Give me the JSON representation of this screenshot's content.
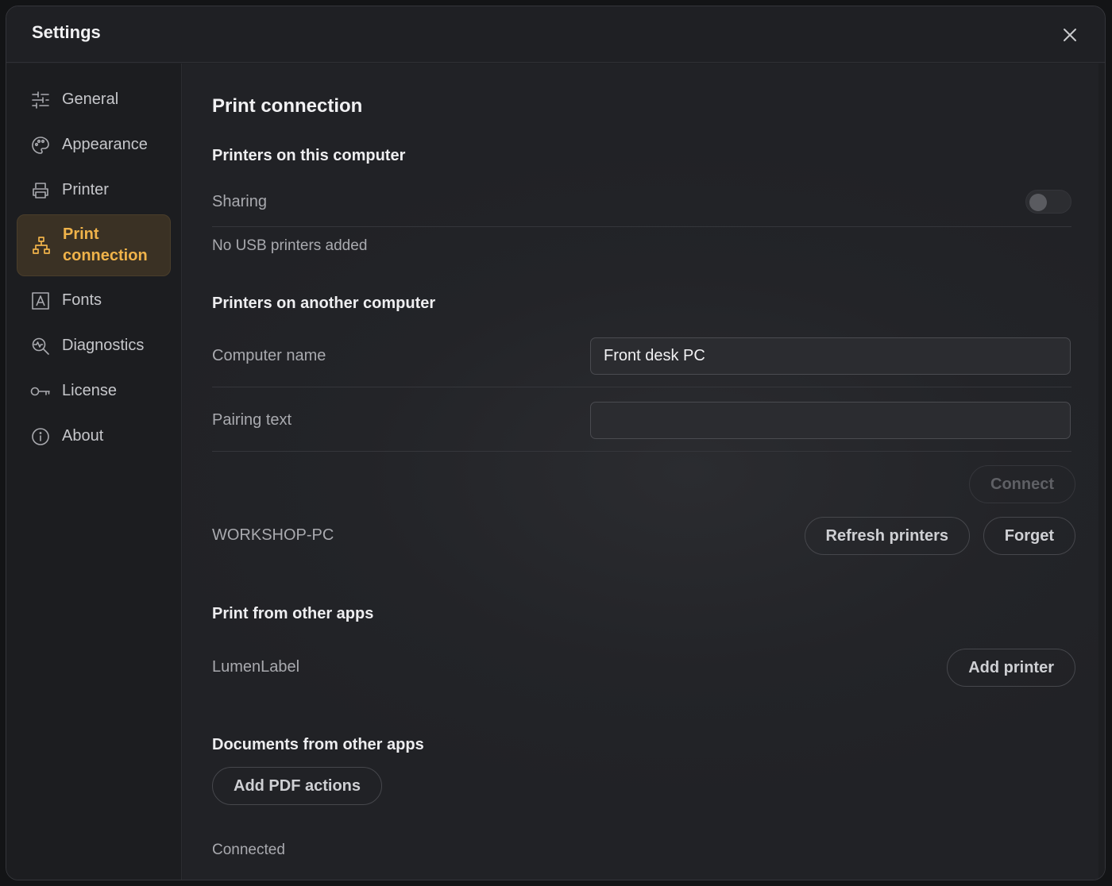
{
  "window": {
    "title": "Settings"
  },
  "sidebar": {
    "items": [
      {
        "label": "General",
        "icon": "sliders-icon"
      },
      {
        "label": "Appearance",
        "icon": "palette-icon"
      },
      {
        "label": "Printer",
        "icon": "printer-icon"
      },
      {
        "label": "Print\nconnection",
        "icon": "network-icon",
        "active": true
      },
      {
        "label": "Fonts",
        "icon": "font-icon"
      },
      {
        "label": "Diagnostics",
        "icon": "diagnostics-icon"
      },
      {
        "label": "License",
        "icon": "key-icon"
      },
      {
        "label": "About",
        "icon": "info-icon"
      }
    ]
  },
  "main": {
    "title": "Print connection",
    "this_computer": {
      "heading": "Printers on this computer",
      "sharing_label": "Sharing",
      "sharing_enabled": false,
      "usb_status": "No USB printers added"
    },
    "another_computer": {
      "heading": "Printers on another computer",
      "computer_name_label": "Computer name",
      "computer_name_value": "Front desk PC",
      "pairing_label": "Pairing text",
      "pairing_value": "",
      "connect_label": "Connect",
      "paired_name": "WORKSHOP-PC",
      "refresh_label": "Refresh printers",
      "forget_label": "Forget"
    },
    "other_apps": {
      "heading": "Print from other apps",
      "app_name": "LumenLabel",
      "add_printer_label": "Add printer"
    },
    "documents": {
      "heading": "Documents from other apps",
      "add_pdf_label": "Add PDF actions",
      "status": "Connected"
    }
  },
  "colors": {
    "accent": "#f0b34a",
    "accent_bg": "#3a3124",
    "background": "#1f2024"
  }
}
